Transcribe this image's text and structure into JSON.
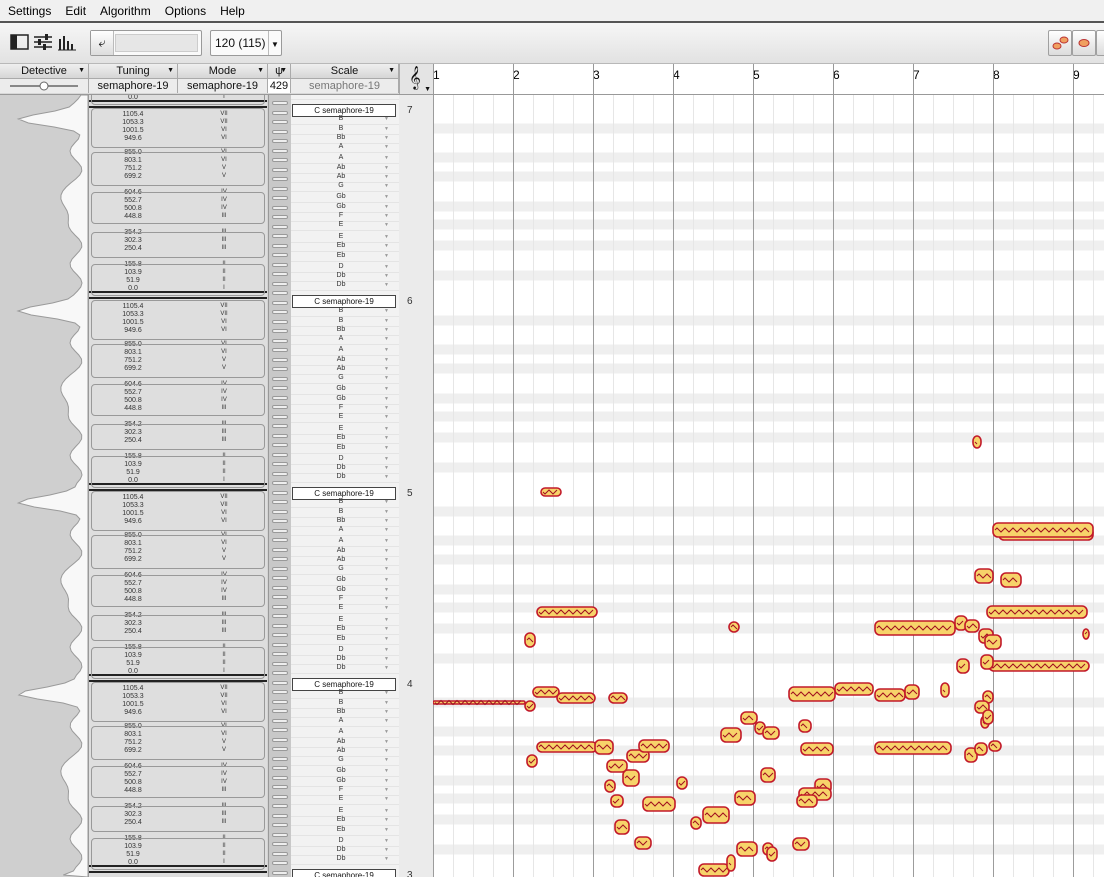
{
  "menubar": {
    "items": [
      "Settings",
      "Edit",
      "Algorithm",
      "Options",
      "Help"
    ]
  },
  "toolbar": {
    "tempo": "120 (115)"
  },
  "columns": {
    "detective": "Detective",
    "tuning": "Tuning",
    "mode": "Mode",
    "scale": "Scale",
    "tuning_value": "semaphore-19",
    "mode_value": "semaphore-19",
    "count_value": "429",
    "scale_value": "semaphore-19"
  },
  "ruler": {
    "bars": [
      "1",
      "2",
      "3",
      "4",
      "5",
      "6",
      "7",
      "8",
      "9"
    ]
  },
  "tuning_rows": [
    {
      "cents": "1105.4",
      "degree": "VII"
    },
    {
      "cents": "1053.3",
      "degree": "VII"
    },
    {
      "cents": "1001.5",
      "degree": "VI"
    },
    {
      "cents": "949.6",
      "degree": "VI"
    },
    {
      "cents": "855.0",
      "degree": "VI"
    },
    {
      "cents": "803.1",
      "degree": "VI"
    },
    {
      "cents": "751.2",
      "degree": "V"
    },
    {
      "cents": "699.2",
      "degree": "V"
    },
    {
      "cents": "604.6",
      "degree": "IV"
    },
    {
      "cents": "552.7",
      "degree": "IV"
    },
    {
      "cents": "500.8",
      "degree": "IV"
    },
    {
      "cents": "448.8",
      "degree": "III"
    },
    {
      "cents": "354.2",
      "degree": "III"
    },
    {
      "cents": "302.3",
      "degree": "III"
    },
    {
      "cents": "250.4",
      "degree": "III"
    },
    {
      "cents": "155.8",
      "degree": "II"
    },
    {
      "cents": "103.9",
      "degree": "II"
    },
    {
      "cents": "51.9",
      "degree": "II"
    },
    {
      "cents": "0.0",
      "degree": "I"
    }
  ],
  "scale_rows": [
    "B",
    "B",
    "Bb",
    "A",
    "A",
    "Ab",
    "Ab",
    "G",
    "Gb",
    "Gb",
    "F",
    "E",
    "E",
    "Eb",
    "Eb",
    "D",
    "Db",
    "Db"
  ],
  "scale_root_label": "C semaphore-19",
  "octaves": [
    "7",
    "6",
    "5",
    "4",
    "3"
  ],
  "colors": {
    "blob_fill": "#f7d36a",
    "blob_edge": "#c21a2a",
    "grid_line": "#bdbdbd",
    "row_shade": "#efefef"
  }
}
